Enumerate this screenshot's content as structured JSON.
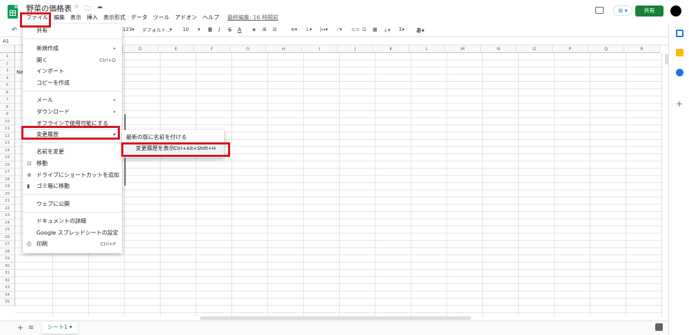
{
  "header": {
    "title": "野菜の価格表",
    "star_icon": "☆",
    "folder_icon": "🗀",
    "cloud_icon": "☁",
    "menus": [
      "ファイル",
      "編集",
      "表示",
      "挿入",
      "表示形式",
      "データ",
      "ツール",
      "アドオン",
      "ヘルプ"
    ],
    "last_edit": "最終編集: 16 時間前",
    "present_label": "⊞ ▾",
    "share_label": "共有"
  },
  "toolbar": {
    "undo": "↶",
    "format_num": "123▾",
    "font": "デフォルト...",
    "font_arrow": "▾",
    "size": "10",
    "size_arrow": "▾",
    "bold": "B",
    "italic": "I",
    "strike": "S",
    "text_color": "A",
    "fill": "◈",
    "borders": "⊞",
    "merge": "⊟",
    "halign": "≡▾",
    "valign": "⊥▾",
    "wrap": "|↦▾",
    "rotate": "⟋▾",
    "link": "⊂⊃",
    "comment": "⊡",
    "chart": "▦",
    "filter": "⏚▾",
    "functions": "Σ▾",
    "input_tools": "あ▾"
  },
  "formula_bar": {
    "cell_ref": "A1"
  },
  "columns": [
    "D",
    "E",
    "F",
    "G",
    "H",
    "I",
    "J",
    "K",
    "L",
    "M",
    "N",
    "O",
    "P",
    "Q",
    "R"
  ],
  "rows": [
    "1",
    "2",
    "3",
    "4",
    "5",
    "6",
    "7",
    "8",
    "9",
    "10",
    "11",
    "12",
    "13",
    "14",
    "15",
    "16",
    "17",
    "18",
    "19",
    "20",
    "21",
    "22",
    "23",
    "24",
    "25",
    "26",
    "27",
    "28",
    "29",
    "30",
    "31",
    "32",
    "33",
    "34",
    "35"
  ],
  "cell_a3": "No",
  "file_menu": {
    "share": "共有",
    "new": "新規作成",
    "open": "開く",
    "open_shortcut": "Ctrl+O",
    "import": "インポート",
    "copy": "コピーを作成",
    "email": "メール",
    "download": "ダウンロード",
    "offline": "オフラインで使用可能にする",
    "version_history": "変更履歴",
    "rename": "名前を変更",
    "move": "移動",
    "add_shortcut": "ドライブにショートカットを追加",
    "trash": "ゴミ箱に移動",
    "publish": "ウェブに公開",
    "details": "ドキュメントの詳細",
    "settings": "Google スプレッドシートの設定",
    "print": "印刷",
    "print_shortcut": "Ctrl+P",
    "submenu_arrow": "▸"
  },
  "version_submenu": {
    "name_version": "最新の版に名前を付ける",
    "see_history": "変更履歴を表示",
    "see_history_shortcut": "Ctrl+Alt+Shift+H"
  },
  "bottom": {
    "add_sheet": "+",
    "all_sheets": "≡",
    "sheet_tab": "シート1 ▾"
  },
  "colors": {
    "highlight": "#d6101e",
    "brand": "#0f9d58",
    "share": "#188038"
  }
}
